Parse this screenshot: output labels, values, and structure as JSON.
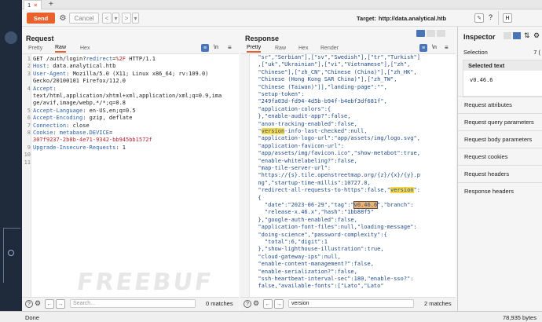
{
  "tabs": [
    {
      "label": "1",
      "close": "×"
    }
  ],
  "add_tab": "+",
  "toolbar": {
    "send": "Send",
    "cancel": "Cancel",
    "back": "<",
    "back_menu": "▾",
    "fwd": ">",
    "fwd_menu": "▾",
    "target_label": "Target:",
    "target": "http://data.analytical.htb",
    "http_label": "H"
  },
  "request": {
    "title": "Request",
    "tabs": [
      "Pretty",
      "Raw",
      "Hex"
    ],
    "active_tab": "Raw",
    "lines": [
      {
        "n": "1",
        "parts": [
          {
            "t": "GET /auth/login?",
            "c": ""
          },
          {
            "t": "redirect",
            "c": "k"
          },
          {
            "t": "=",
            "c": ""
          },
          {
            "t": "%2F",
            "c": "v"
          },
          {
            "t": " HTTP/1.1",
            "c": ""
          }
        ]
      },
      {
        "n": "2",
        "parts": [
          {
            "t": "Host",
            "c": "k"
          },
          {
            "t": ": data.analytical.htb",
            "c": ""
          }
        ]
      },
      {
        "n": "3",
        "parts": [
          {
            "t": "User-Agent",
            "c": "k"
          },
          {
            "t": ": Mozilla/5.0 (X11; Linux x86_64; rv:109.0)",
            "c": ""
          }
        ]
      },
      {
        "n": "",
        "parts": [
          {
            "t": "Gecko/20100101 Firefox/112.0",
            "c": ""
          }
        ]
      },
      {
        "n": "4",
        "parts": [
          {
            "t": "Accept",
            "c": "k"
          },
          {
            "t": ":",
            "c": ""
          }
        ]
      },
      {
        "n": "",
        "parts": [
          {
            "t": "text/html,application/xhtml+xml,application/xml;q=0.9,ima",
            "c": ""
          }
        ]
      },
      {
        "n": "",
        "parts": [
          {
            "t": "ge/avif,image/webp,*/*;q=0.8",
            "c": ""
          }
        ]
      },
      {
        "n": "5",
        "parts": [
          {
            "t": "Accept-Language",
            "c": "k"
          },
          {
            "t": ": en-US,en;q=0.5",
            "c": ""
          }
        ]
      },
      {
        "n": "6",
        "parts": [
          {
            "t": "Accept-Encoding",
            "c": "k"
          },
          {
            "t": ": gzip, deflate",
            "c": ""
          }
        ]
      },
      {
        "n": "7",
        "parts": [
          {
            "t": "Connection",
            "c": "k"
          },
          {
            "t": ": close",
            "c": ""
          }
        ]
      },
      {
        "n": "8",
        "parts": [
          {
            "t": "Cookie",
            "c": "k"
          },
          {
            "t": ": ",
            "c": ""
          },
          {
            "t": "metabase.DEVICE",
            "c": "k"
          },
          {
            "t": "=",
            "c": ""
          }
        ]
      },
      {
        "n": "",
        "parts": [
          {
            "t": "307f9237-2b0b-4e71-9342-bb945bb1572f",
            "c": "v"
          }
        ]
      },
      {
        "n": "9",
        "parts": [
          {
            "t": "Upgrade-Insecure-Requests",
            "c": "k"
          },
          {
            "t": ": 1",
            "c": ""
          }
        ]
      },
      {
        "n": "10",
        "parts": []
      },
      {
        "n": "11",
        "parts": []
      }
    ],
    "search_placeholder": "Search...",
    "matches": "0 matches"
  },
  "response": {
    "title": "Response",
    "tabs": [
      "Pretty",
      "Raw",
      "Hex",
      "Render"
    ],
    "active_tab": "Pretty",
    "lines": [
      [
        {
          "t": "  \"sr\",\"Serbian\"],[\"sv\",\"Swedish\"],[\"tr\",\"Turkish\"]"
        }
      ],
      [
        {
          "t": "  ,[\"uk\",\"Ukrainian\"],[\"vi\",\"Vietnamese\"],[\"zh\","
        }
      ],
      [
        {
          "t": "  \"Chinese\"],[\"zh_CN\",\"Chinese (China)\"],[\"zh_HK\","
        }
      ],
      [
        {
          "t": "  \"Chinese (Hong Kong SAR China)\"],[\"zh_TW\","
        }
      ],
      [
        {
          "t": "  \"Chinese (Taiwan)\"]],\"landing-page\":\"\","
        }
      ],
      [
        {
          "t": "  \"setup-token\":"
        }
      ],
      [
        {
          "t": "  \"249fa03d-fd94-4d5b-b94f-b4ebf3df681f\","
        }
      ],
      [
        {
          "t": "  \"application-colors\":{"
        }
      ],
      [
        {
          "t": "  },\"enable-audit-app?\":false,"
        }
      ],
      [
        {
          "t": "  \"anon-tracking-enabled\":false,"
        }
      ],
      [
        {
          "t": "  \""
        },
        {
          "t": "version",
          "h": "hl"
        },
        {
          "t": "-info-last-checked\":null,"
        }
      ],
      [
        {
          "t": "  \"application-logo-url\":\"app/assets/img/logo.svg\","
        }
      ],
      [
        {
          "t": "  \"application-favicon-url\":"
        }
      ],
      [
        {
          "t": "  \"app/assets/img/favicon.ico\",\"show-metabot\":true,"
        }
      ],
      [
        {
          "t": "  \"enable-whitelabeling?\":false,"
        }
      ],
      [
        {
          "t": "  \"map-tile-server-url\":"
        }
      ],
      [
        {
          "t": "  \"https://{s}.tile.openstreetmap.org/{z}/{x}/{y}.p"
        }
      ],
      [
        {
          "t": "  ng\",\"startup-time-millis\":10727.0,"
        }
      ],
      [
        {
          "t": "  \"redirect-all-requests-to-https\":false,\""
        },
        {
          "t": "version",
          "h": "hl"
        },
        {
          "t": "\":"
        }
      ],
      [
        {
          "t": "  {"
        }
      ],
      [
        {
          "t": "    \"date\":\"2023-06-29\",\"tag\":\""
        },
        {
          "t": "v0.46.6",
          "h": "hl2"
        },
        {
          "t": "\",\"branch\":"
        }
      ],
      [
        {
          "t": "    \"release-x.46.x\",\"hash\":\"1bb88f5\""
        }
      ],
      [
        {
          "t": "  },\"google-auth-enabled\":false,"
        }
      ],
      [
        {
          "t": "  \"application-font-files\":null,\"loading-message\":"
        }
      ],
      [
        {
          "t": "  \"doing-science\",\"password-complexity\":{"
        }
      ],
      [
        {
          "t": "    \"total\":6,\"digit\":1"
        }
      ],
      [
        {
          "t": "  },\"show-lighthouse-illustration\":true,"
        }
      ],
      [
        {
          "t": "  \"cloud-gateway-ips\":null,"
        }
      ],
      [
        {
          "t": "  \"enable-content-management?\":false,"
        }
      ],
      [
        {
          "t": "  \"enable-serialization?\":false,"
        }
      ],
      [
        {
          "t": "  \"ssh-heartbeat-interval-sec\":180,\"enable-sso?\":"
        }
      ],
      [
        {
          "t": "  false,\"available-fonts\":[\"Lato\",\"Lato\""
        }
      ]
    ],
    "search_value": "version",
    "matches": "2 matches"
  },
  "inspector": {
    "title": "Inspector",
    "selection_label": "Selection",
    "selection_count": "7",
    "selected_text_label": "Selected text",
    "selected_value": "v0.46.6",
    "sections": [
      "Request attributes",
      "Request query parameters",
      "Request body parameters",
      "Request cookies",
      "Request headers",
      "Response headers"
    ]
  },
  "status": {
    "left": "Done",
    "right": "78,935 bytes"
  },
  "watermark": "FREEBUF"
}
